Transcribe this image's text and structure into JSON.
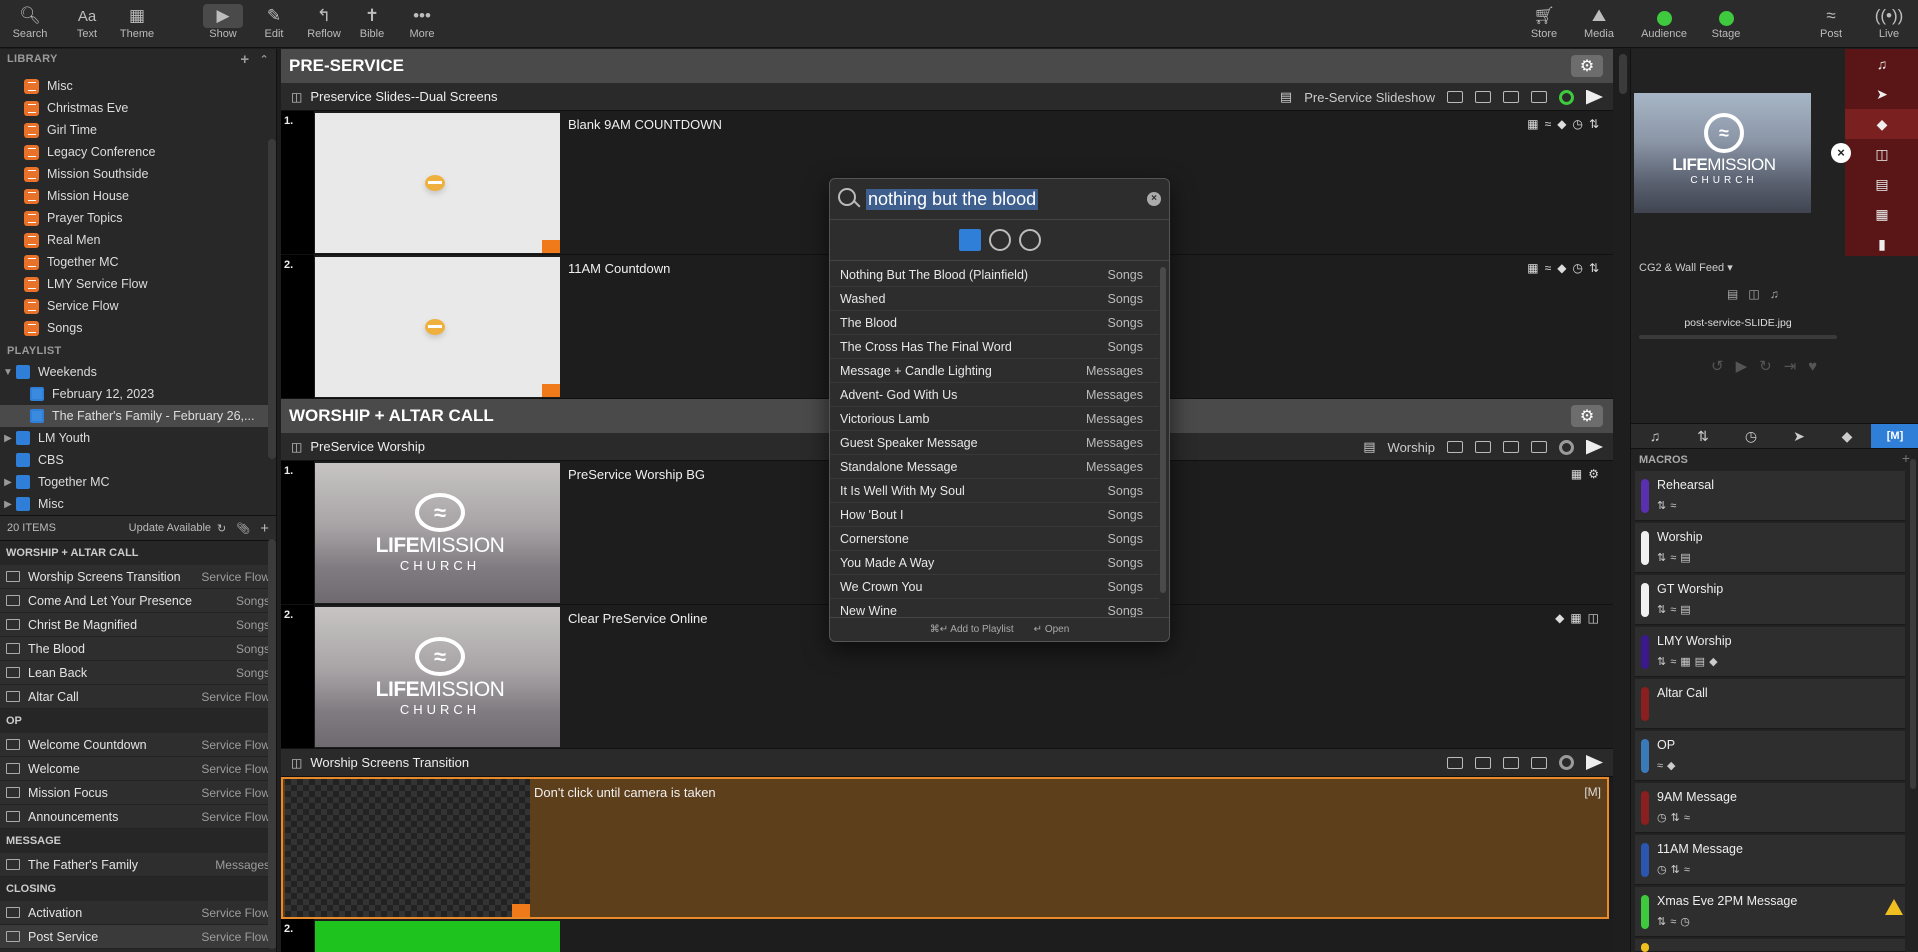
{
  "toolbar": {
    "search": "Search",
    "text": "Text",
    "theme": "Theme",
    "show": "Show",
    "edit": "Edit",
    "reflow": "Reflow",
    "bible": "Bible",
    "more": "More",
    "store": "Store",
    "media": "Media",
    "audience": "Audience",
    "stage": "Stage",
    "post": "Post",
    "live": "Live"
  },
  "library": {
    "header": "LIBRARY",
    "items": [
      "Misc",
      "Christmas Eve",
      "Girl Time",
      "Legacy Conference",
      "Mission Southside",
      "Mission House",
      "Prayer Topics",
      "Real Men",
      "Together MC",
      "LMY Service Flow",
      "Service Flow",
      "Songs"
    ]
  },
  "playlist": {
    "header": "PLAYLIST",
    "weekends": "Weekends",
    "sub1": "February 12, 2023",
    "sub2": "The Father's Family - February 26,...",
    "others": [
      "LM Youth",
      "CBS",
      "Together MC",
      "Misc"
    ]
  },
  "items_bar": {
    "count": "20 ITEMS",
    "update": "Update Available"
  },
  "playlist_items": {
    "g1": "WORSHIP + ALTAR CALL",
    "g1_items": [
      {
        "name": "Worship Screens Transition",
        "type": "Service Flow"
      },
      {
        "name": "Come And Let Your Presence",
        "type": "Songs"
      },
      {
        "name": "Christ Be Magnified",
        "type": "Songs"
      },
      {
        "name": "The Blood",
        "type": "Songs"
      },
      {
        "name": "Lean Back",
        "type": "Songs"
      },
      {
        "name": "Altar Call",
        "type": "Service Flow"
      }
    ],
    "g2": "OP",
    "g2_items": [
      {
        "name": "Welcome Countdown",
        "type": "Service Flow"
      },
      {
        "name": "Welcome",
        "type": "Service Flow"
      },
      {
        "name": "Mission Focus",
        "type": "Service Flow"
      },
      {
        "name": "Announcements",
        "type": "Service Flow"
      }
    ],
    "g3": "MESSAGE",
    "g3_items": [
      {
        "name": "The Father's Family",
        "type": "Messages"
      }
    ],
    "g4": "CLOSING",
    "g4_items": [
      {
        "name": "Activation",
        "type": "Service Flow"
      },
      {
        "name": "Post Service",
        "type": "Service Flow"
      }
    ]
  },
  "main": {
    "group1": "PRE-SERVICE",
    "pres1": "Preservice Slides--Dual Screens",
    "pres1_tag": "Pre-Service Slideshow",
    "s1_num": "1.",
    "s1_title": "Blank 9AM COUNTDOWN",
    "s2_num": "2.",
    "s2_title": "11AM Countdown",
    "group2": "WORSHIP + ALTAR CALL",
    "pres2": "PreService Worship",
    "pres2_tag": "Worship",
    "s3_num": "1.",
    "s3_title": "PreService Worship BG",
    "s4_num": "2.",
    "s4_title": "Clear PreService Online",
    "pres3": "Worship Screens Transition",
    "s5_num": "1.",
    "s5_title": "Don't click until camera is taken",
    "s6_num": "2.",
    "logo_life": "LIFE",
    "logo_mission": "MISSION",
    "logo_church": "CHURCH"
  },
  "search": {
    "query": "nothing but the blood",
    "results": [
      {
        "name": "Nothing But The Blood (Plainfield)",
        "type": "Songs"
      },
      {
        "name": "Washed",
        "type": "Songs"
      },
      {
        "name": "The Blood",
        "type": "Songs"
      },
      {
        "name": "The Cross Has The Final Word",
        "type": "Songs"
      },
      {
        "name": "Message + Candle Lighting",
        "type": "Messages"
      },
      {
        "name": "Advent- God With Us",
        "type": "Messages"
      },
      {
        "name": "Victorious Lamb",
        "type": "Messages"
      },
      {
        "name": "Guest Speaker Message",
        "type": "Messages"
      },
      {
        "name": "Standalone Message",
        "type": "Messages"
      },
      {
        "name": "It Is Well With My Soul",
        "type": "Songs"
      },
      {
        "name": "How 'Bout I",
        "type": "Songs"
      },
      {
        "name": "Cornerstone",
        "type": "Songs"
      },
      {
        "name": "You Made A Way",
        "type": "Songs"
      },
      {
        "name": "We Crown You",
        "type": "Songs"
      },
      {
        "name": "New Wine",
        "type": "Songs"
      }
    ],
    "add_hint": "⌘↵ Add to Playlist",
    "open_hint": "↵ Open"
  },
  "right": {
    "feed": "CG2 & Wall Feed",
    "file": "post-service-SLIDE.jpg",
    "macros_header": "MACROS",
    "macros": [
      {
        "name": "Rehearsal",
        "color": "#5a2fb0"
      },
      {
        "name": "Worship",
        "color": "#f0f0f0"
      },
      {
        "name": "GT Worship",
        "color": "#f0f0f0"
      },
      {
        "name": "LMY Worship",
        "color": "#3a1a8a"
      },
      {
        "name": "Altar Call",
        "color": "#8a1f1f"
      },
      {
        "name": "OP",
        "color": "#3a7ab8"
      },
      {
        "name": "9AM Message",
        "color": "#8a1f1f"
      },
      {
        "name": "11AM Message",
        "color": "#2a56b0"
      },
      {
        "name": "Xmas Eve 2PM Message",
        "color": "#3ec93e"
      }
    ]
  },
  "colors": {
    "accent": "#2f7fd8",
    "orange": "#e8722a",
    "green": "#3ec93e"
  }
}
